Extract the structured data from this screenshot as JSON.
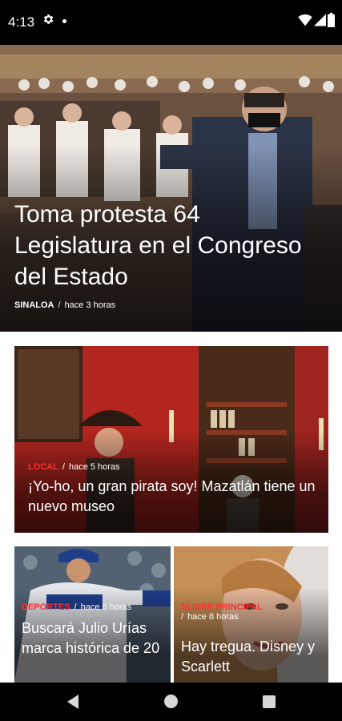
{
  "status_bar": {
    "time": "4:13",
    "icons": [
      "gear-icon",
      "notification-dot-icon",
      "wifi-icon",
      "signal-icon",
      "battery-icon"
    ]
  },
  "hero": {
    "title": "Toma protesta 64 Legislatura en el Congreso del Estado",
    "category": "SINALOA",
    "separator": "/",
    "time": "hace 3 horas"
  },
  "feed": [
    {
      "category": "LOCAL",
      "separator": "/",
      "time": "hace 5 horas",
      "title": "¡Yo-ho, un gran pirata soy! Mazatlán tiene un nuevo museo"
    },
    {
      "category": "DEPORTES",
      "separator": "/",
      "time": "hace 6 horas",
      "title": "Buscará Julio Urías marca histórica de 20"
    },
    {
      "category": "SLIDER PRINCIPAL",
      "separator": "/",
      "time": "hace 8 horas",
      "title": "Hay tregua. Disney y Scarlett"
    }
  ],
  "colors": {
    "category_accent": "#ff3030",
    "status_bar_bg": "#000000",
    "nav_bar_bg": "#000000"
  },
  "nav_bar": {
    "icons": [
      "back-icon",
      "home-icon",
      "recents-icon"
    ]
  }
}
